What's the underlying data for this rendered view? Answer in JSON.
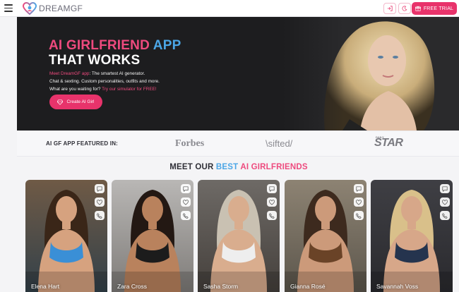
{
  "header": {
    "brand": "DREAMGF",
    "trial_label": "FREE TRIAL",
    "icons": [
      "menu-icon",
      "login-icon",
      "theme-moon-icon",
      "gift-icon"
    ]
  },
  "hero": {
    "title_part1": "AI GIRLFRIEND",
    "title_part2": "APP",
    "title_line2": "THAT WORKS",
    "copy_accent1": "Meet DreamGF app",
    "copy_rest1": ": The smartest AI generator.",
    "copy_line2": "Chat & sexting. Custom personalities, outfits and more.",
    "copy_line3a": "What are you waiting for?",
    "copy_line3b": " Try our simulator for FREE!",
    "cta": "Create AI Girl"
  },
  "featured": {
    "label": "AI GF APP FEATURED IN:",
    "logos": [
      "Forbes",
      "\\sifted/",
      "STAR"
    ],
    "star_small": "DAILY"
  },
  "section": {
    "title_a": "MEET OUR ",
    "title_b": "BEST",
    "title_c": " AI GIRLFRIENDS"
  },
  "girls": [
    {
      "name": "Elena Hart"
    },
    {
      "name": "Zara Cross"
    },
    {
      "name": "Sasha Storm"
    },
    {
      "name": "Gianna Rosé"
    },
    {
      "name": "Savannah Voss"
    }
  ],
  "colors": {
    "accent_pink": "#e8336b",
    "accent_blue": "#4ba6e6",
    "hero_bg": "#1d1d1f"
  }
}
